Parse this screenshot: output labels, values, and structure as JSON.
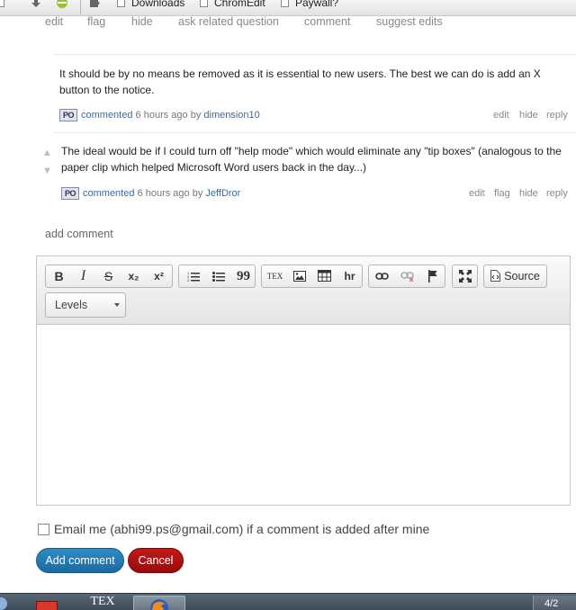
{
  "bookmarks": [
    {
      "label": "Downloads"
    },
    {
      "label": "ChromEdit"
    },
    {
      "label": "Paywall?"
    }
  ],
  "post_menu": [
    "edit",
    "flag",
    "hide",
    "ask related question",
    "comment",
    "suggest edits"
  ],
  "comments": [
    {
      "text": "It should be by no means be removed as it is essential to new users. The best we can do is add an X button to the notice.",
      "avatar": "PO",
      "commented": "commented",
      "time": "6 hours ago",
      "by": "by",
      "author": "dimension10",
      "actions": [
        "edit",
        "hide",
        "reply"
      ]
    },
    {
      "text": "The ideal would be if I could turn off \"help mode\" which would eliminate any \"tip boxes\" (analogous to the paper clip which helped Microsoft Word users back in the day...)",
      "avatar": "PO",
      "commented": "commented",
      "time": "6 hours ago",
      "by": "by",
      "author": "JeffDror",
      "actions": [
        "edit",
        "flag",
        "hide",
        "reply"
      ]
    }
  ],
  "add_comment_label": "add comment",
  "editor": {
    "toolbar": {
      "bold": "B",
      "italic": "I",
      "strike": "S",
      "subscript": "x₂",
      "superscript": "x²",
      "blockquote": "99",
      "tex": "TEX",
      "hr": "hr",
      "source": "Source"
    },
    "format_dropdown": "Levels"
  },
  "email_notify": "Email me (abhi99.ps@gmail.com) if a comment is added after mine",
  "buttons": {
    "add_comment": "Add comment",
    "cancel": "Cancel"
  },
  "taskbar": {
    "tex_label": "TEX",
    "clock_fragment": "4/2"
  }
}
